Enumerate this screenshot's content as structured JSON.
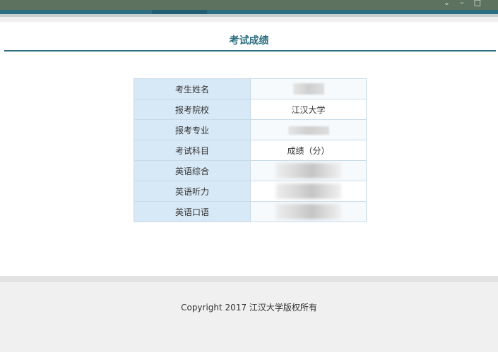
{
  "page": {
    "title": "考试成绩"
  },
  "result_table": {
    "rows": [
      {
        "label": "考生姓名",
        "value": ""
      },
      {
        "label": "报考院校",
        "value": "江汉大学"
      },
      {
        "label": "报考专业",
        "value": ""
      },
      {
        "label": "考试科目",
        "value": "成绩（分）"
      },
      {
        "label": "英语综合",
        "value": ""
      },
      {
        "label": "英语听力",
        "value": ""
      },
      {
        "label": "英语口语",
        "value": ""
      }
    ]
  },
  "footer": {
    "copyright": "Copyright 2017 江汉大学版权所有"
  },
  "colors": {
    "accent": "#2b6e81",
    "label_cell_bg": "#d7e8f6",
    "window_bar": "#5d725f"
  },
  "icons": [
    "minimize-icon",
    "restore-icon",
    "close-icon"
  ]
}
